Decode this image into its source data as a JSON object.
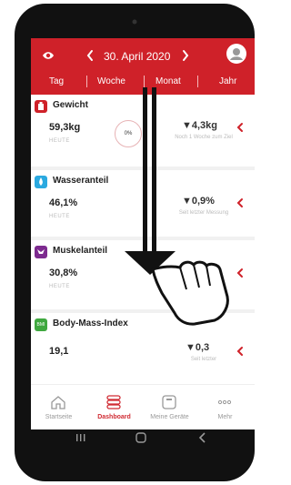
{
  "header": {
    "date": "30. April 2020",
    "tabs": [
      "Tag",
      "Woche",
      "Monat",
      "Jahr"
    ]
  },
  "colors": {
    "brand": "#cf2129",
    "water": "#2aa9e0",
    "muscle": "#7d2b8f",
    "bmi": "#3fa83f",
    "nav_active": "#d02b33"
  },
  "cards": [
    {
      "title": "Gewicht",
      "value": "59,3kg",
      "sub": "HEUTE",
      "change": "▼4,3kg",
      "note": "Noch 1 Woche zum Ziel",
      "badge": "0%",
      "icon": "weight-icon"
    },
    {
      "title": "Wasseranteil",
      "value": "46,1%",
      "sub": "HEUTE",
      "change": "▼0,9%",
      "note": "Seit letzter Messung",
      "icon": "water-drop-icon"
    },
    {
      "title": "Muskelanteil",
      "value": "30,8%",
      "sub": "HEUTE",
      "icon": "muscle-icon"
    },
    {
      "title": "Body-Mass-Index",
      "value": "19,1",
      "change": "▼0,3",
      "note": "Seit letzter",
      "icon_text": "BMI",
      "icon": "bmi-icon"
    }
  ],
  "nav": [
    {
      "label": "Startseite",
      "icon": "home-icon",
      "active": false
    },
    {
      "label": "Dashboard",
      "icon": "dashboard-icon",
      "active": true
    },
    {
      "label": "Meine Geräte",
      "icon": "scale-device-icon",
      "active": false
    },
    {
      "label": "Mehr",
      "icon": "more-icon",
      "active": false
    }
  ]
}
